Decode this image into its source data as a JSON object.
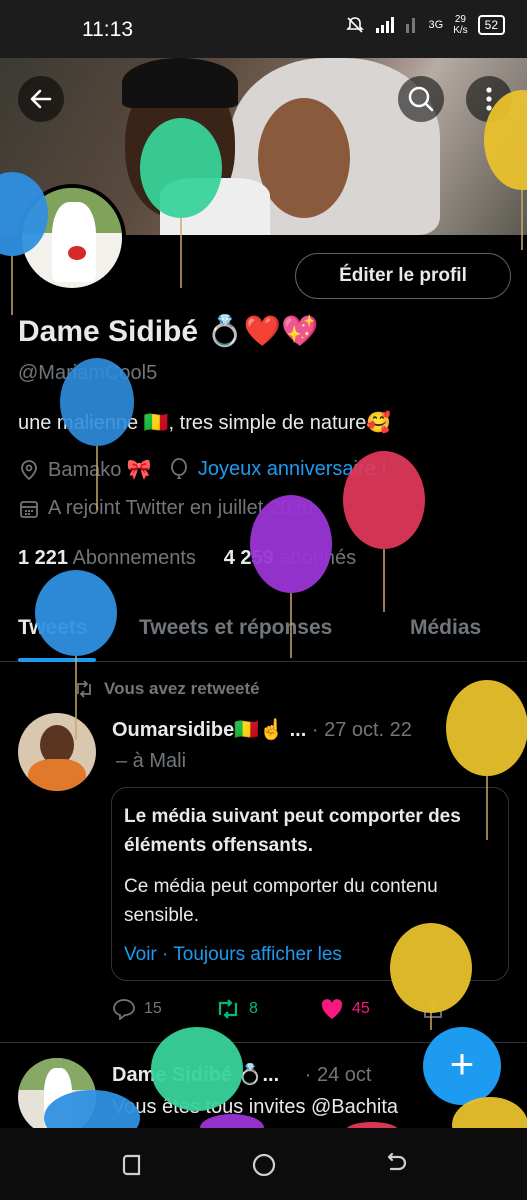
{
  "status_bar": {
    "time": "11:13",
    "network": "3G",
    "speed_value": "29",
    "speed_unit": "K/s",
    "battery": "52"
  },
  "header": {
    "back_icon": "arrow-left-icon",
    "search_icon": "search-icon",
    "more_icon": "more-vertical-icon"
  },
  "profile": {
    "edit_button": "Éditer le profil",
    "name": "Dame Sidibé 💍❤️💖",
    "handle": "@MariamCool5",
    "bio": "une malienne 🇲🇱, tres simple de nature🥰",
    "location": "Bamako 🎀",
    "birthday_link": "Joyeux anniversaire !",
    "joined": "A rejoint Twitter en juillet 2020",
    "following_count": "1 221",
    "following_label": "Abonnements",
    "followers_count": "4 259",
    "followers_label": "abonnés"
  },
  "tabs": [
    {
      "label": "Tweets",
      "active": true
    },
    {
      "label": "Tweets et réponses",
      "active": false
    },
    {
      "label": "Médias",
      "active": false
    }
  ],
  "tweets": [
    {
      "retweet_label": "Vous avez retweeté",
      "author": "Oumarsidibe🇲🇱☝️ ...",
      "date": "· 27 oct. 22",
      "location": "– à Mali",
      "sensitive_title": "Le média suivant peut comporter des éléments offensants.",
      "sensitive_body": "Ce média peut comporter du contenu sensible.",
      "sensitive_link": "Voir · Toujours afficher les",
      "replies": "15",
      "retweets": "8",
      "likes": "45"
    },
    {
      "author": "Dame Sidibé 💍...",
      "date": "· 24 oct",
      "text": "Vous êtes tous invites @Bachita"
    }
  ],
  "fab_label": "+",
  "colors": {
    "accent": "#1d9bf0",
    "retweet": "#00ba7c",
    "like": "#f91880",
    "muted": "#71767b"
  }
}
